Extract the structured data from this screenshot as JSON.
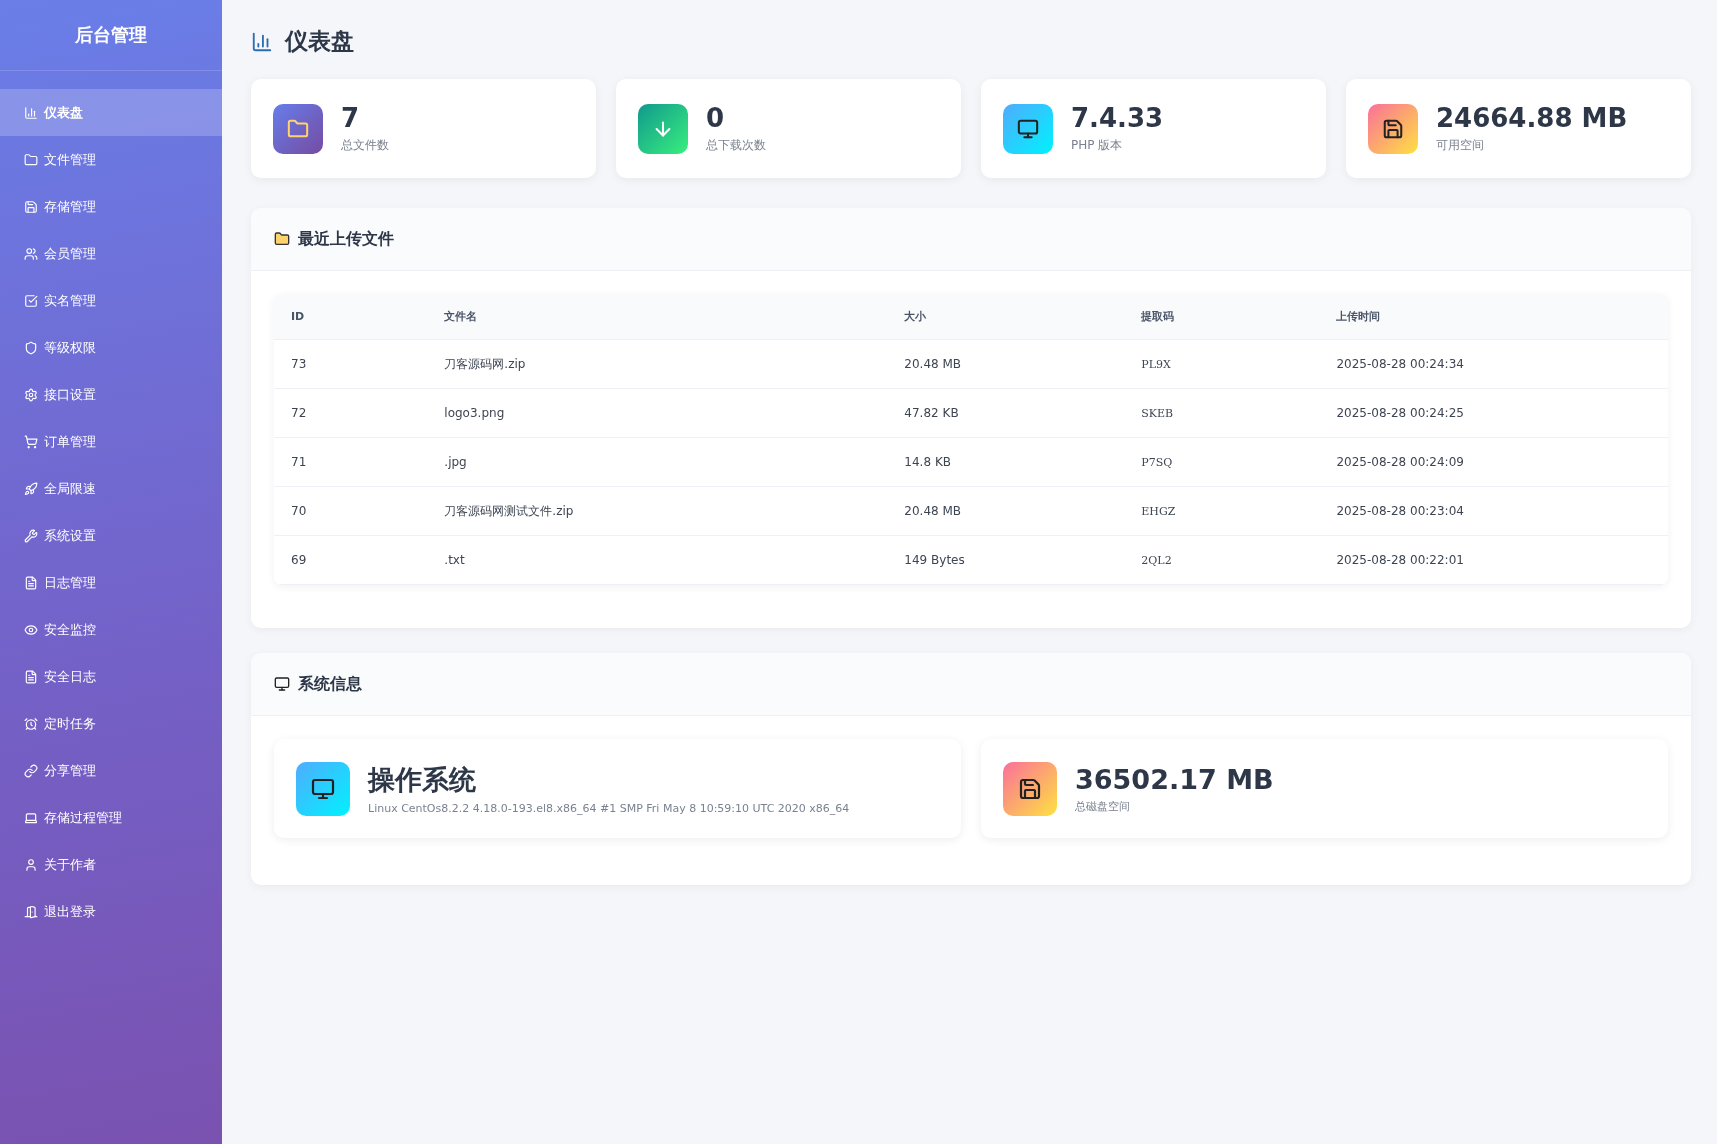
{
  "sidebar": {
    "title": "后台管理",
    "items": [
      {
        "label": "仪表盘",
        "selected": true
      },
      {
        "label": "文件管理",
        "selected": false
      },
      {
        "label": "存储管理",
        "selected": false
      },
      {
        "label": "会员管理",
        "selected": false
      },
      {
        "label": "实名管理",
        "selected": false
      },
      {
        "label": "等级权限",
        "selected": false
      },
      {
        "label": "接口设置",
        "selected": false
      },
      {
        "label": "订单管理",
        "selected": false
      },
      {
        "label": "全局限速",
        "selected": false
      },
      {
        "label": "系统设置",
        "selected": false
      },
      {
        "label": "日志管理",
        "selected": false
      },
      {
        "label": "安全监控",
        "selected": false
      },
      {
        "label": "安全日志",
        "selected": false
      },
      {
        "label": "定时任务",
        "selected": false
      },
      {
        "label": "分享管理",
        "selected": false
      },
      {
        "label": "存储过程管理",
        "selected": false
      },
      {
        "label": "关于作者",
        "selected": false
      },
      {
        "label": "退出登录",
        "selected": false
      }
    ]
  },
  "page_title": "仪表盘",
  "stats": [
    {
      "value": "7",
      "label": "总文件数"
    },
    {
      "value": "0",
      "label": "总下载次数"
    },
    {
      "value": "7.4.33",
      "label": "PHP 版本"
    },
    {
      "value": "24664.88 MB",
      "label": "可用空间"
    }
  ],
  "recent_files": {
    "title": "最近上传文件",
    "columns": [
      "ID",
      "文件名",
      "大小",
      "提取码",
      "上传时间"
    ],
    "rows": [
      [
        "73",
        "刀客源码网.zip",
        "20.48 MB",
        "PL9X",
        "2025-08-28 00:24:34"
      ],
      [
        "72",
        "logo3.png",
        "47.82 KB",
        "SKEB",
        "2025-08-28 00:24:25"
      ],
      [
        "71",
        ".jpg",
        "14.8 KB",
        "P7SQ",
        "2025-08-28 00:24:09"
      ],
      [
        "70",
        "刀客源码网测试文件.zip",
        "20.48 MB",
        "EHGZ",
        "2025-08-28 00:23:04"
      ],
      [
        "69",
        ".txt",
        "149 Bytes",
        "2QL2",
        "2025-08-28 00:22:01"
      ]
    ]
  },
  "system_info": {
    "title": "系统信息",
    "items": [
      {
        "value": "操作系统",
        "label": "Linux CentOs8.2.2 4.18.0-193.el8.x86_64 #1 SMP Fri May 8 10:59:10 UTC 2020 x86_64"
      },
      {
        "value": "36502.17 MB",
        "label": "总磁盘空间"
      }
    ]
  }
}
